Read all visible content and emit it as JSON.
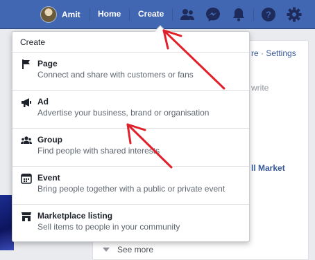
{
  "topbar": {
    "profile_name": "Amit",
    "home_label": "Home",
    "create_label": "Create",
    "icons": [
      "friends-icon",
      "messenger-icon",
      "notifications-icon",
      "help-icon",
      "settings-icon"
    ]
  },
  "background": {
    "settings_text": "re · Settings",
    "write_text": "write",
    "market_text": "ll Market",
    "see_more": "See more"
  },
  "menu": {
    "header": "Create",
    "items": [
      {
        "icon": "flag-icon",
        "title": "Page",
        "desc": "Connect and share with customers or fans"
      },
      {
        "icon": "megaphone-icon",
        "title": "Ad",
        "desc": "Advertise your business, brand or organisation"
      },
      {
        "icon": "group-icon",
        "title": "Group",
        "desc": "Find people with shared interests"
      },
      {
        "icon": "calendar-icon",
        "title": "Event",
        "desc": "Bring people together with a public or private event"
      },
      {
        "icon": "storefront-icon",
        "title": "Marketplace listing",
        "desc": "Sell items to people in your community"
      }
    ]
  },
  "colors": {
    "topbar": "#4267b2",
    "annotation_arrow": "#e0202a",
    "link": "#385898"
  }
}
